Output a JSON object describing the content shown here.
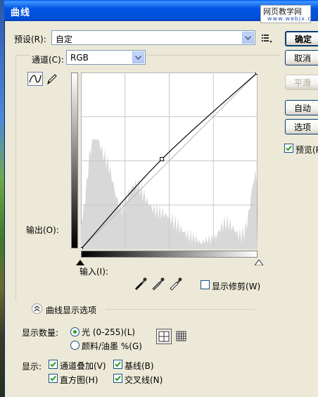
{
  "window": {
    "title": "曲线"
  },
  "watermark": {
    "line1": "网页教学网",
    "line2": "www.webjx.com"
  },
  "preset": {
    "label": "预设(R):",
    "value": "自定"
  },
  "channel": {
    "label": "通道(C):",
    "value": "RGB"
  },
  "graph": {
    "output_label": "输出(O):",
    "input_label": "输入(I):",
    "curve_points": [
      [
        0,
        0
      ],
      [
        117,
        130
      ],
      [
        255,
        255
      ]
    ],
    "histogram_color": "#d8d8d8",
    "curve_color": "#000000"
  },
  "buttons": {
    "ok": "确定",
    "cancel": "取消",
    "smooth": "平滑",
    "auto": "自动",
    "options": "选项"
  },
  "preview": {
    "label": "预览(P",
    "checked": true
  },
  "clipping": {
    "label": "显示修剪(W)",
    "checked": false
  },
  "display_options": {
    "header": "曲线显示选项",
    "show_amount_label": "显示数量:",
    "light_label": "光 (0-255)(L)",
    "pigment_label": "颜料/油墨 %(G)",
    "selected": "light",
    "show_label": "显示:",
    "channel_overlay": {
      "label": "通道叠加(V)",
      "checked": true
    },
    "baseline": {
      "label": "基线(B)",
      "checked": true
    },
    "histogram": {
      "label": "直方图(H)",
      "checked": true
    },
    "intersection": {
      "label": "交叉线(N)",
      "checked": true
    }
  }
}
